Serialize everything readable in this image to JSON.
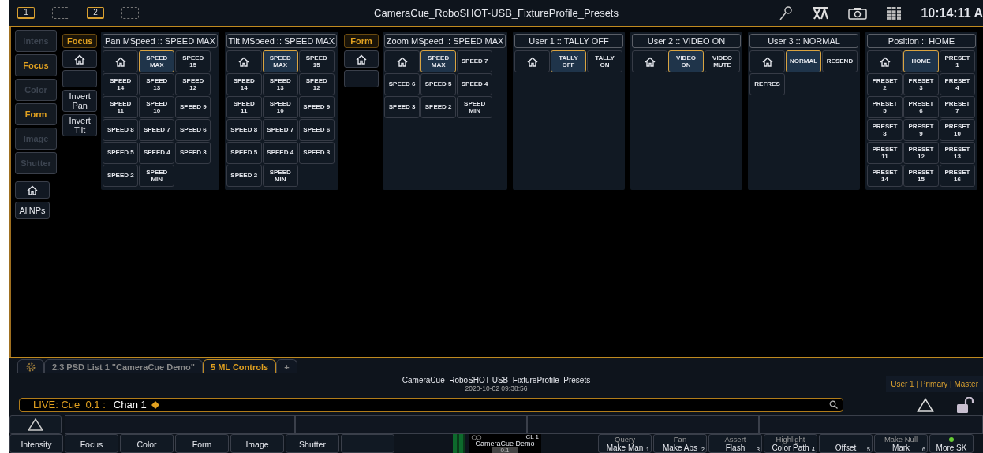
{
  "top_bar": {
    "screens": [
      {
        "kind": "numbered",
        "label": "1",
        "selected": true
      },
      {
        "kind": "blank",
        "selected": false
      },
      {
        "kind": "numbered",
        "label": "2",
        "selected": true
      },
      {
        "kind": "blank",
        "selected": false
      }
    ],
    "title": "CameraCue_RoboSHOT-USB_FixtureProfile_Presets",
    "clock": "10:14:11 A"
  },
  "categories": [
    {
      "label": "Intens",
      "enabled": false
    },
    {
      "label": "Focus",
      "enabled": true
    },
    {
      "label": "Color",
      "enabled": false
    },
    {
      "label": "Form",
      "enabled": true
    },
    {
      "label": "Image",
      "enabled": false
    },
    {
      "label": "Shutter",
      "enabled": false
    }
  ],
  "category_extras": [
    {
      "kind": "home"
    },
    {
      "kind": "text",
      "label": "AllNPs"
    }
  ],
  "focus_column": {
    "label": "Focus",
    "buttons": [
      {
        "kind": "home"
      },
      {
        "kind": "text",
        "label": "-"
      },
      {
        "kind": "text",
        "label": "Invert\nPan"
      },
      {
        "kind": "text",
        "label": "Invert\nTilt"
      }
    ]
  },
  "form_column": {
    "label": "Form",
    "buttons": [
      {
        "kind": "home"
      },
      {
        "kind": "text",
        "label": "-"
      }
    ]
  },
  "panels": [
    {
      "header": "Pan MSpeed :: SPEED MAX",
      "buttons": [
        {
          "kind": "home",
          "selected": false
        },
        {
          "kind": "text",
          "label": "SPEED\nMAX",
          "selected": true
        },
        {
          "kind": "text",
          "label": "SPEED\n15",
          "selected": false
        },
        {
          "kind": "text",
          "label": "SPEED\n14",
          "selected": false
        },
        {
          "kind": "text",
          "label": "SPEED\n13",
          "selected": false
        },
        {
          "kind": "text",
          "label": "SPEED\n12",
          "selected": false
        },
        {
          "kind": "text",
          "label": "SPEED\n11",
          "selected": false
        },
        {
          "kind": "text",
          "label": "SPEED\n10",
          "selected": false
        },
        {
          "kind": "text",
          "label": "SPEED 9",
          "selected": false
        },
        {
          "kind": "text",
          "label": "SPEED 8",
          "selected": false
        },
        {
          "kind": "text",
          "label": "SPEED 7",
          "selected": false
        },
        {
          "kind": "text",
          "label": "SPEED 6",
          "selected": false
        },
        {
          "kind": "text",
          "label": "SPEED 5",
          "selected": false
        },
        {
          "kind": "text",
          "label": "SPEED 4",
          "selected": false
        },
        {
          "kind": "text",
          "label": "SPEED 3",
          "selected": false
        },
        {
          "kind": "text",
          "label": "SPEED 2",
          "selected": false
        },
        {
          "kind": "text",
          "label": "SPEED\nMIN",
          "selected": false
        }
      ]
    },
    {
      "header": "Tilt MSpeed :: SPEED MAX",
      "buttons": [
        {
          "kind": "home",
          "selected": false
        },
        {
          "kind": "text",
          "label": "SPEED\nMAX",
          "selected": true
        },
        {
          "kind": "text",
          "label": "SPEED\n15",
          "selected": false
        },
        {
          "kind": "text",
          "label": "SPEED\n14",
          "selected": false
        },
        {
          "kind": "text",
          "label": "SPEED\n13",
          "selected": false
        },
        {
          "kind": "text",
          "label": "SPEED\n12",
          "selected": false
        },
        {
          "kind": "text",
          "label": "SPEED\n11",
          "selected": false
        },
        {
          "kind": "text",
          "label": "SPEED\n10",
          "selected": false
        },
        {
          "kind": "text",
          "label": "SPEED 9",
          "selected": false
        },
        {
          "kind": "text",
          "label": "SPEED 8",
          "selected": false
        },
        {
          "kind": "text",
          "label": "SPEED 7",
          "selected": false
        },
        {
          "kind": "text",
          "label": "SPEED 6",
          "selected": false
        },
        {
          "kind": "text",
          "label": "SPEED 5",
          "selected": false
        },
        {
          "kind": "text",
          "label": "SPEED 4",
          "selected": false
        },
        {
          "kind": "text",
          "label": "SPEED 3",
          "selected": false
        },
        {
          "kind": "text",
          "label": "SPEED 2",
          "selected": false
        },
        {
          "kind": "text",
          "label": "SPEED\nMIN",
          "selected": false
        }
      ]
    },
    {
      "header": "Zoom MSpeed :: SPEED MAX",
      "buttons": [
        {
          "kind": "home",
          "selected": false
        },
        {
          "kind": "text",
          "label": "SPEED\nMAX",
          "selected": true
        },
        {
          "kind": "text",
          "label": "SPEED 7",
          "selected": false
        },
        {
          "kind": "text",
          "label": "SPEED 6",
          "selected": false
        },
        {
          "kind": "text",
          "label": "SPEED 5",
          "selected": false
        },
        {
          "kind": "text",
          "label": "SPEED 4",
          "selected": false
        },
        {
          "kind": "text",
          "label": "SPEED 3",
          "selected": false
        },
        {
          "kind": "text",
          "label": "SPEED 2",
          "selected": false
        },
        {
          "kind": "text",
          "label": "SPEED\nMIN",
          "selected": false
        }
      ]
    },
    {
      "header": "User 1 :: TALLY OFF",
      "buttons": [
        {
          "kind": "home",
          "selected": false
        },
        {
          "kind": "text",
          "label": "TALLY\nOFF",
          "selected": true
        },
        {
          "kind": "text",
          "label": "TALLY\nON",
          "selected": false
        }
      ]
    },
    {
      "header": "User 2 :: VIDEO ON",
      "buttons": [
        {
          "kind": "home",
          "selected": false
        },
        {
          "kind": "text",
          "label": "VIDEO\nON",
          "selected": true
        },
        {
          "kind": "text",
          "label": "VIDEO\nMUTE",
          "selected": false
        }
      ]
    },
    {
      "header": "User 3 :: NORMAL",
      "buttons": [
        {
          "kind": "home",
          "selected": false
        },
        {
          "kind": "text",
          "label": "NORMAL",
          "selected": true
        },
        {
          "kind": "text",
          "label": "RESEND",
          "selected": false
        },
        {
          "kind": "text",
          "label": "REFRES",
          "selected": false
        }
      ]
    },
    {
      "header": "Position :: HOME",
      "buttons": [
        {
          "kind": "home",
          "selected": false
        },
        {
          "kind": "text",
          "label": "HOME",
          "selected": true
        },
        {
          "kind": "text",
          "label": "PRESET\n1",
          "selected": false
        },
        {
          "kind": "text",
          "label": "PRESET\n2",
          "selected": false
        },
        {
          "kind": "text",
          "label": "PRESET\n3",
          "selected": false
        },
        {
          "kind": "text",
          "label": "PRESET\n4",
          "selected": false
        },
        {
          "kind": "text",
          "label": "PRESET\n5",
          "selected": false
        },
        {
          "kind": "text",
          "label": "PRESET\n6",
          "selected": false
        },
        {
          "kind": "text",
          "label": "PRESET\n7",
          "selected": false
        },
        {
          "kind": "text",
          "label": "PRESET\n8",
          "selected": false
        },
        {
          "kind": "text",
          "label": "PRESET\n9",
          "selected": false
        },
        {
          "kind": "text",
          "label": "PRESET\n10",
          "selected": false
        },
        {
          "kind": "text",
          "label": "PRESET\n11",
          "selected": false
        },
        {
          "kind": "text",
          "label": "PRESET\n12",
          "selected": false
        },
        {
          "kind": "text",
          "label": "PRESET\n13",
          "selected": false
        },
        {
          "kind": "text",
          "label": "PRESET\n14",
          "selected": false
        },
        {
          "kind": "text",
          "label": "PRESET\n15",
          "selected": false
        },
        {
          "kind": "text",
          "label": "PRESET\n16",
          "selected": false
        }
      ]
    }
  ],
  "tabs": [
    {
      "kind": "settings",
      "selected": false
    },
    {
      "kind": "text",
      "label": "2.3 PSD List 1 \"CameraCue Demo\"",
      "selected": false
    },
    {
      "kind": "text",
      "label": "5 ML Controls",
      "selected": true
    },
    {
      "kind": "text",
      "label": "+",
      "selected": false
    }
  ],
  "show": {
    "name": "CameraCue_RoboSHOT-USB_FixtureProfile_Presets",
    "date": "2020-10-02 09:38:56",
    "user": "User 1 | Primary | Master"
  },
  "command_line": {
    "prefix": "LIVE: Cue  0.1 :",
    "target": "Chan 1"
  },
  "softkeys_left": [
    {
      "kind": "single",
      "label": "Intensity"
    },
    {
      "kind": "single",
      "label": "Focus"
    },
    {
      "kind": "single",
      "label": "Color"
    },
    {
      "kind": "single",
      "label": "Form"
    },
    {
      "kind": "single",
      "label": "Image"
    },
    {
      "kind": "single",
      "label": "Shutter"
    },
    {
      "kind": "blank"
    }
  ],
  "cue_widget": {
    "list": "CL 1",
    "name": "CameraCue Demo",
    "cue": "0.1"
  },
  "softkeys_right": [
    {
      "kind": "double",
      "top": "Query",
      "label": "Make Man",
      "number": "1"
    },
    {
      "kind": "double",
      "top": "Fan",
      "label": "Make Abs",
      "number": "2"
    },
    {
      "kind": "double",
      "top": "Assert",
      "label": "Flash",
      "number": "3"
    },
    {
      "kind": "double",
      "top": "Highlight",
      "label": "Color Path",
      "number": "4"
    },
    {
      "kind": "single",
      "label": "Offset",
      "number": "5"
    },
    {
      "kind": "double",
      "top": "Make Null",
      "label": "Mark",
      "number": "6"
    },
    {
      "kind": "led",
      "label": "More SK"
    }
  ]
}
